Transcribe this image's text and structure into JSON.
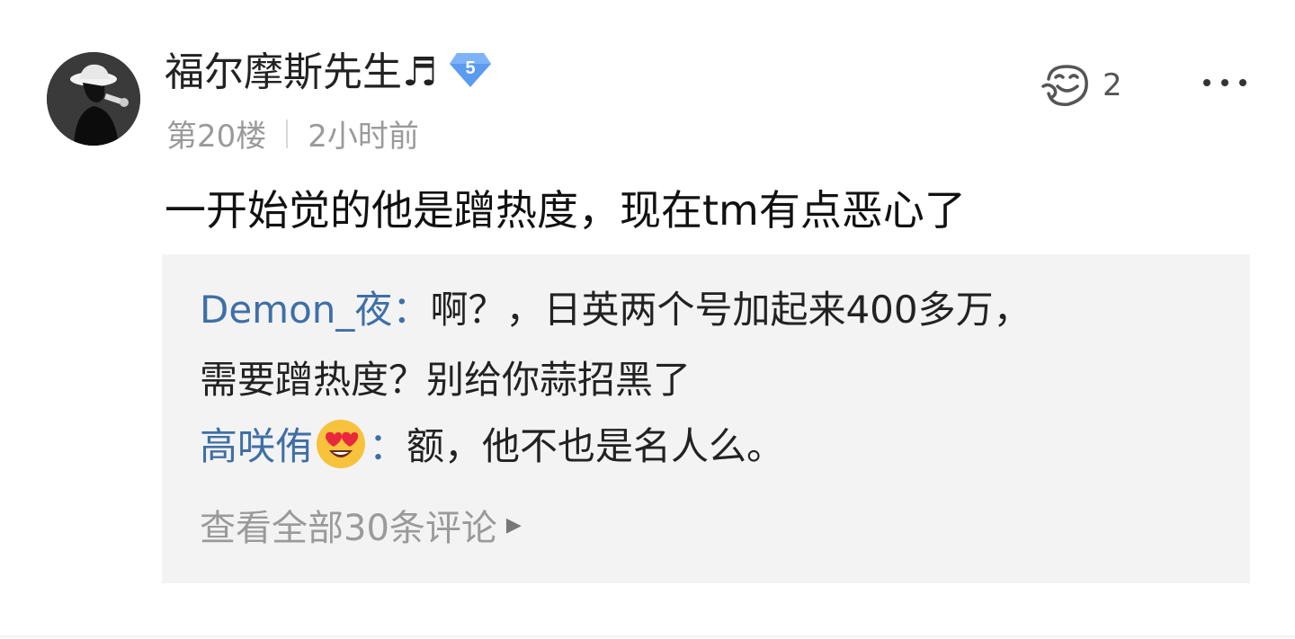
{
  "comment": {
    "username": "福尔摩斯先生♬",
    "level": "5",
    "floor": "第20楼",
    "time": "2小时前",
    "likes": "2",
    "content": "一开始觉的他是蹭热度，现在tm有点恶心了"
  },
  "replies": [
    {
      "user": "Demon_夜",
      "separator": "：",
      "text_line1": "啊？，日英两个号加起来400多万，",
      "text_line2": "需要蹭热度？别给你蒜招黑了"
    },
    {
      "user": "高咲侑",
      "separator": "：",
      "text": "额，他不也是名人么。"
    }
  ],
  "view_all_label": "查看全部30条评论",
  "colors": {
    "reply_user": "#3f6fa6",
    "badge": "#5b9bf0",
    "meta": "#9a9a9a",
    "reply_bg": "#f3f3f3"
  },
  "icons": {
    "like": "like-face-icon",
    "more": "more-dots-icon",
    "level": "diamond-level-icon",
    "emoji": "heart-eyes-emoji-icon",
    "arrow": "triangle-right-icon"
  }
}
